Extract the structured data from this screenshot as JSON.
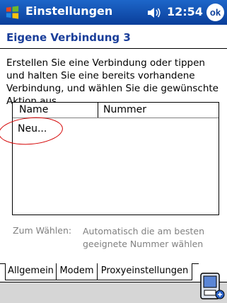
{
  "titlebar": {
    "title": "Einstellungen",
    "time": "12:54",
    "ok_label": "ok"
  },
  "header": "Eigene Verbindung 3",
  "description": "Erstellen Sie eine Verbindung oder tippen und halten Sie eine bereits vorhandene Verbindung, und wählen Sie die gewünschte Aktion aus.",
  "list": {
    "columns": [
      "Name",
      "Nummer"
    ],
    "rows": [
      {
        "name": "Neu...",
        "number": ""
      }
    ]
  },
  "dial": {
    "label": "Zum Wählen:",
    "value": "Automatisch die am besten geeignete Nummer wählen"
  },
  "tabs": [
    {
      "label": "Allgemein",
      "active": false
    },
    {
      "label": "Modem",
      "active": true
    },
    {
      "label": "Proxyeinstellungen",
      "active": false
    }
  ],
  "colors": {
    "titlebar": "#0a3e9a",
    "header": "#1a3e9a",
    "highlight_circle": "#d40000"
  }
}
